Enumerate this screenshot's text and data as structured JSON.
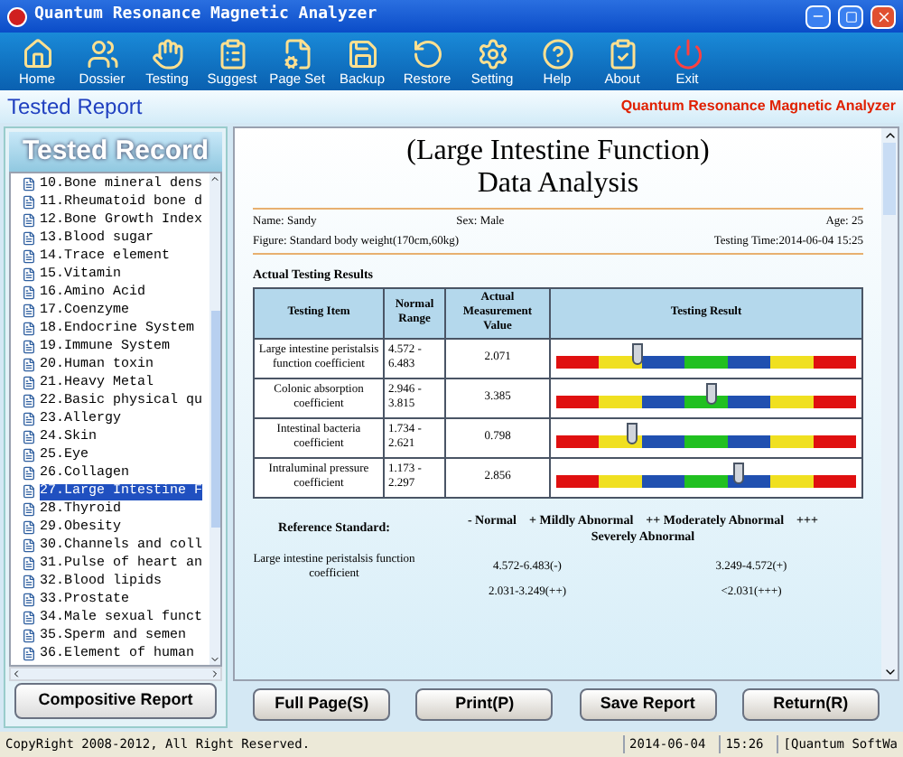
{
  "window": {
    "title": "Quantum Resonance Magnetic Analyzer"
  },
  "toolbar": [
    "Home",
    "Dossier",
    "Testing",
    "Suggest",
    "Page Set",
    "Backup",
    "Restore",
    "Setting",
    "Help",
    "About",
    "Exit"
  ],
  "header": {
    "title": "Tested Report",
    "brand": "Quantum Resonance Magnetic Analyzer"
  },
  "sidebar": {
    "title": "Tested Record",
    "items": [
      {
        "label": "10.Bone mineral dens",
        "selected": false
      },
      {
        "label": "11.Rheumatoid bone d",
        "selected": false
      },
      {
        "label": "12.Bone Growth Index",
        "selected": false
      },
      {
        "label": "13.Blood sugar",
        "selected": false
      },
      {
        "label": "14.Trace element",
        "selected": false
      },
      {
        "label": "15.Vitamin",
        "selected": false
      },
      {
        "label": "16.Amino Acid",
        "selected": false
      },
      {
        "label": "17.Coenzyme",
        "selected": false
      },
      {
        "label": "18.Endocrine System",
        "selected": false
      },
      {
        "label": "19.Immune System",
        "selected": false
      },
      {
        "label": "20.Human toxin",
        "selected": false
      },
      {
        "label": "21.Heavy Metal",
        "selected": false
      },
      {
        "label": "22.Basic physical qu",
        "selected": false
      },
      {
        "label": "23.Allergy",
        "selected": false
      },
      {
        "label": "24.Skin",
        "selected": false
      },
      {
        "label": "25.Eye",
        "selected": false
      },
      {
        "label": "26.Collagen",
        "selected": false
      },
      {
        "label": "27.Large Intestine F",
        "selected": true
      },
      {
        "label": "28.Thyroid",
        "selected": false
      },
      {
        "label": "29.Obesity",
        "selected": false
      },
      {
        "label": "30.Channels and coll",
        "selected": false
      },
      {
        "label": "31.Pulse of heart an",
        "selected": false
      },
      {
        "label": "32.Blood lipids",
        "selected": false
      },
      {
        "label": "33.Prostate",
        "selected": false
      },
      {
        "label": "34.Male sexual funct",
        "selected": false
      },
      {
        "label": "35.Sperm and semen",
        "selected": false
      },
      {
        "label": "36.Element of human",
        "selected": false
      }
    ],
    "button": "Compositive Report"
  },
  "report": {
    "title_1": "(Large Intestine Function)",
    "title_2": "Data Analysis",
    "name": "Name: Sandy",
    "sex": "Sex: Male",
    "age": "Age: 25",
    "figure": "Figure: Standard body weight(170cm,60kg)",
    "time": "Testing Time:2014-06-04 15:25",
    "section": "Actual Testing Results",
    "columns": [
      "Testing Item",
      "Normal Range",
      "Actual Measurement Value",
      "Testing Result"
    ],
    "rows": [
      {
        "item": "Large intestine peristalsis function coefficient",
        "range": "4.572 - 6.483",
        "value": "2.071",
        "level": 0.27
      },
      {
        "item": "Colonic absorption coefficient",
        "range": "2.946 - 3.815",
        "value": "3.385",
        "level": 0.52
      },
      {
        "item": "Intestinal bacteria coefficient",
        "range": "1.734 - 2.621",
        "value": "0.798",
        "level": 0.25
      },
      {
        "item": "Intraluminal pressure coefficient",
        "range": "1.173 - 2.297",
        "value": "2.856",
        "level": 0.61
      }
    ],
    "reference_label": "Reference Standard:",
    "reference_legend": "- Normal    + Mildly Abnormal    ++ Moderately Abnormal    +++ Severely Abnormal",
    "reference_item": "Large intestine peristalsis function coefficient",
    "reference_values": [
      "4.572-6.483(-)",
      "3.249-4.572(+)",
      "2.031-3.249(++)",
      "<2.031(+++)"
    ]
  },
  "buttons": [
    "Full Page(S)",
    "Print(P)",
    "Save Report",
    "Return(R)"
  ],
  "status_bar": [
    "CopyRight 2008-2012, All Right Reserved.",
    "2014-06-04",
    "15:26",
    "[Quantum SoftWa"
  ]
}
